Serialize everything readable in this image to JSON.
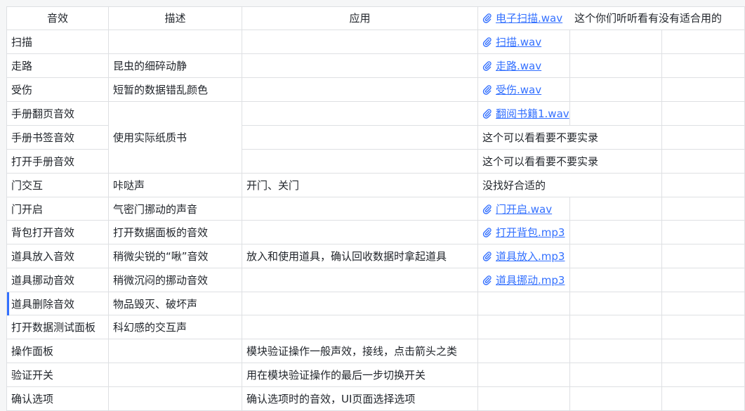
{
  "headers": [
    "音效",
    "描述",
    "应用"
  ],
  "header_link": "电子扫描.wav",
  "header_note": "这个你们听听看有没有适合用的",
  "rows": [
    {
      "name": "扫描",
      "desc": "",
      "app": "",
      "file": "扫描.wav",
      "note": ""
    },
    {
      "name": "走路",
      "desc": "昆虫的细碎动静",
      "app": "",
      "file": "走路.wav",
      "note": ""
    },
    {
      "name": "受伤",
      "desc": "短暂的数据错乱颜色",
      "app": "",
      "file": "受伤.wav",
      "note": ""
    },
    {
      "name": "手册翻页音效",
      "desc": "",
      "app": "",
      "file": "翻阅书籍1.wav",
      "note": ""
    },
    {
      "name": "手册书签音效",
      "desc": "使用实际纸质书",
      "app": "",
      "file": "",
      "note": "这个可以看看要不要实录"
    },
    {
      "name": "打开手册音效",
      "desc": "",
      "app": "",
      "file": "",
      "note": "这个可以看看要不要实录"
    },
    {
      "name": "门交互",
      "desc": "咔哒声",
      "app": "开门、关门",
      "file": "",
      "note": "没找好合适的"
    },
    {
      "name": "门开启",
      "desc": "气密门挪动的声音",
      "app": "",
      "file": "门开启.wav",
      "note": ""
    },
    {
      "name": "背包打开音效",
      "desc": "打开数据面板的音效",
      "app": "",
      "file": "打开背包.mp3",
      "note": ""
    },
    {
      "name": "道具放入音效",
      "desc": "稍微尖锐的“啾”音效",
      "app": "放入和使用道具，确认回收数据时拿起道具",
      "file": "道具放入.mp3",
      "note": ""
    },
    {
      "name": "道具挪动音效",
      "desc": "稍微沉闷的挪动音效",
      "app": "",
      "file": "道具挪动.mp3",
      "note": ""
    },
    {
      "name": "道具删除音效",
      "desc": "物品毁灭、破坏声",
      "app": "",
      "file": "",
      "note": ""
    },
    {
      "name": "打开数据测试面板",
      "desc": "科幻感的交互声",
      "app": "",
      "file": "",
      "note": ""
    },
    {
      "name": "操作面板",
      "desc": "",
      "app": "模块验证操作一般声效，接线，点击箭头之类",
      "file": "",
      "note": ""
    },
    {
      "name": "验证开关",
      "desc": "",
      "app": "用在模块验证操作的最后一步切换开关",
      "file": "",
      "note": ""
    },
    {
      "name": "确认选项",
      "desc": "",
      "app": "确认选项时的音效，UI页面选择选项",
      "file": "",
      "note": ""
    }
  ],
  "colors": {
    "link": "#3370ff",
    "grid": "#dee0e3",
    "text": "#1f2329"
  }
}
